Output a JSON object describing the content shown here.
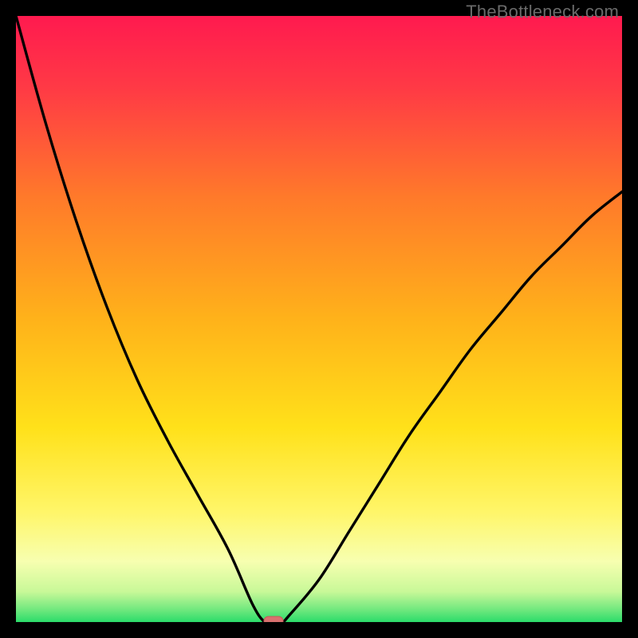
{
  "watermark": "TheBottleneck.com",
  "colors": {
    "background": "#000000",
    "gradient_top": "#ff1a4f",
    "gradient_upper_mid": "#ff7a2a",
    "gradient_mid": "#ffd21a",
    "gradient_lower_mid": "#fff88a",
    "gradient_bottom": "#2bdc6a",
    "curve": "#000000",
    "marker_fill": "#d9716f",
    "marker_stroke": "#c65a58"
  },
  "chart_data": {
    "type": "line",
    "title": "",
    "xlabel": "",
    "ylabel": "",
    "xlim": [
      0,
      100
    ],
    "ylim": [
      0,
      100
    ],
    "grid": false,
    "legend": false,
    "series": [
      {
        "name": "bottleneck-curve",
        "x": [
          0,
          5,
          10,
          15,
          20,
          25,
          30,
          35,
          39,
          41,
          42,
          43,
          44,
          45,
          50,
          55,
          60,
          65,
          70,
          75,
          80,
          85,
          90,
          95,
          100
        ],
        "values": [
          100,
          82,
          66,
          52,
          40,
          30,
          21,
          12,
          3,
          0,
          0,
          0,
          0,
          1,
          7,
          15,
          23,
          31,
          38,
          45,
          51,
          57,
          62,
          67,
          71
        ]
      }
    ],
    "marker": {
      "x": 42.5,
      "y": 0,
      "label": "optimal-point"
    },
    "annotations": []
  }
}
